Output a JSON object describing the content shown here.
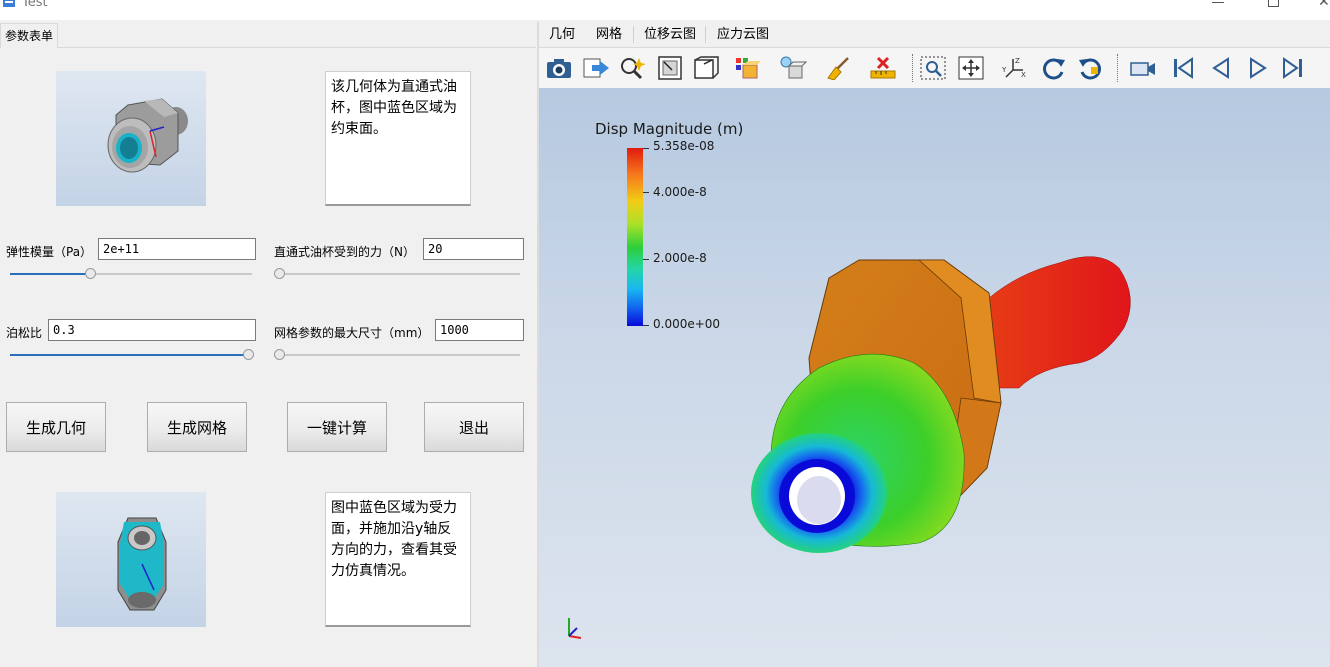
{
  "window": {
    "title": "Test"
  },
  "left_tab": {
    "label": "参数表单"
  },
  "top_description": "该几何体为直通式油杯，图中蓝色区域为约束面。",
  "bottom_description": "图中蓝色区域为受力面，并施加沿y轴反方向的力，查看其受力仿真情况。",
  "params": {
    "youngs_modulus": {
      "label": "弹性模量（Pa）",
      "value": "2e+11",
      "slider_fraction": 0.33
    },
    "force": {
      "label": "直通式油杯受到的力（N）",
      "value": "20",
      "slider_fraction": 0.0
    },
    "poisson": {
      "label": "泊松比",
      "value": "0.3",
      "slider_fraction": 1.0
    },
    "mesh_size": {
      "label": "网格参数的最大尺寸（mm）",
      "value": "1000",
      "slider_fraction": 0.0
    }
  },
  "buttons": {
    "generate_geometry": "生成几何",
    "generate_mesh": "生成网格",
    "one_click_compute": "一键计算",
    "exit": "退出"
  },
  "menu": [
    "几何",
    "网格",
    "位移云图",
    "应力云图"
  ],
  "toolbar_icons": [
    "camera-icon",
    "export-icon",
    "magic-zoom-icon",
    "view-frame-icon",
    "view-box-icon",
    "color-cubes-icon",
    "light-cube-icon",
    "broom-icon",
    "ruler-delete-icon",
    "zoom-region-icon",
    "fit-all-icon",
    "axes-icon",
    "rotate-cw-icon",
    "rotate-ccw-icon",
    "video-camera-icon",
    "first-frame-icon",
    "prev-frame-icon",
    "play-icon",
    "last-frame-icon"
  ],
  "legend": {
    "title": "Disp Magnitude (m)",
    "max_label": "5.358e-08",
    "mid_high_label": "4.000e-8",
    "mid_low_label": "2.000e-8",
    "min_label": "0.000e+00",
    "max_value": 5.358e-08,
    "min_value": 0
  },
  "colors": {
    "accent": "#2a6fbd",
    "result_max": "#e01b10",
    "result_min": "#0a0ad8"
  }
}
